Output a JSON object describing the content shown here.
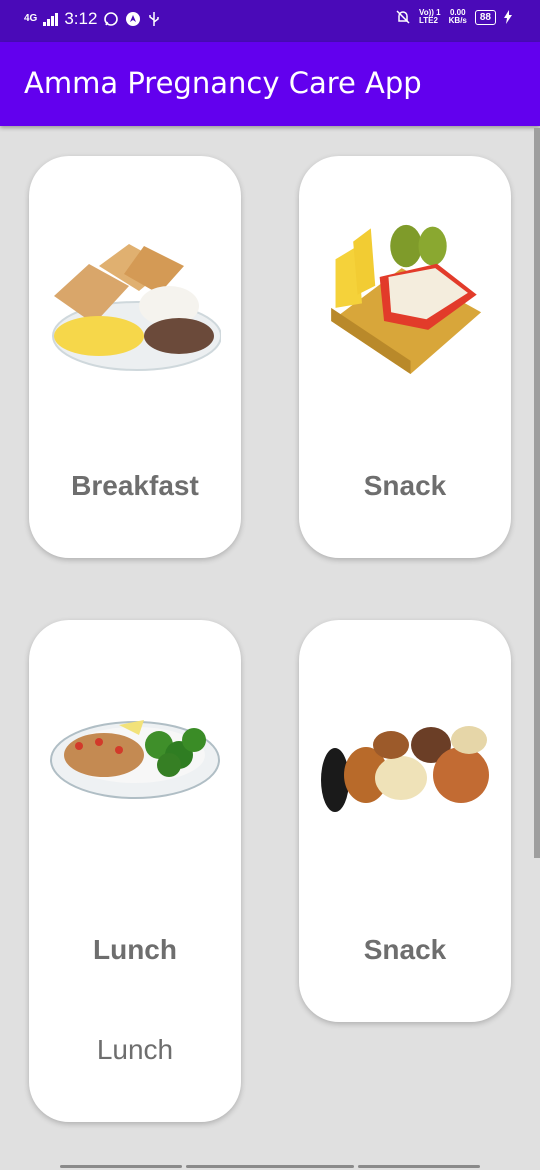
{
  "status_bar": {
    "network": "4G",
    "time": "3:12",
    "volte": "Vo)) 1\nLTE2",
    "speed": "0.00\nKB/s",
    "battery": "88"
  },
  "app": {
    "title": "Amma Pregnancy Care App"
  },
  "cards": [
    {
      "label": "Breakfast",
      "image": "breakfast-image"
    },
    {
      "label": "Snack",
      "image": "cheese-snack-image"
    },
    {
      "label": "Lunch",
      "sublabel": "Lunch",
      "image": "lunch-image"
    },
    {
      "label": "Snack",
      "image": "dry-fruits-image"
    }
  ]
}
